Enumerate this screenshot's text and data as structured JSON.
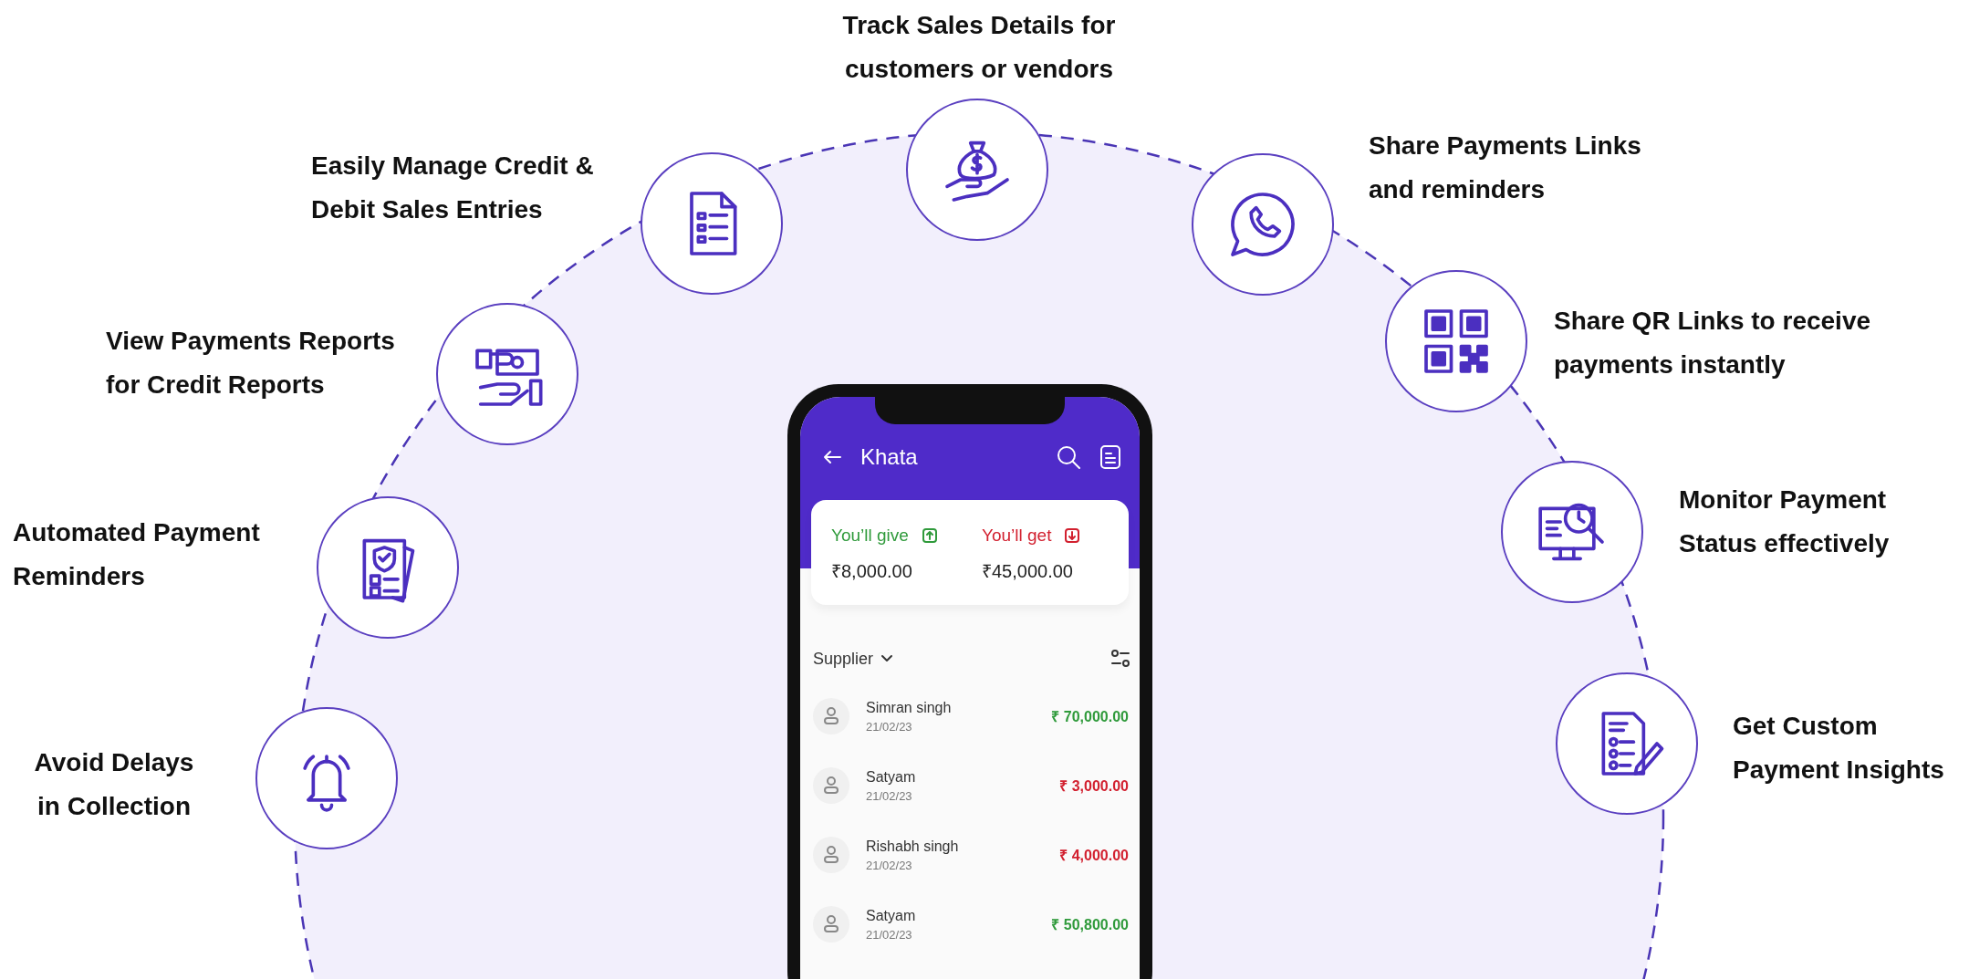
{
  "features": [
    {
      "kind": "moneybag",
      "lines": [
        "Track Sales Details for",
        "customers or vendors"
      ]
    },
    {
      "kind": "chat",
      "lines": [
        "Share Payments Links",
        "and reminders"
      ]
    },
    {
      "kind": "document",
      "lines": [
        "Easily Manage Credit &",
        "Debit Sales Entries"
      ]
    },
    {
      "kind": "qr",
      "lines": [
        "Share QR Links to receive",
        "payments instantly"
      ]
    },
    {
      "kind": "cash",
      "lines": [
        "View Payments Reports",
        "for Credit Reports"
      ]
    },
    {
      "kind": "monitor",
      "lines": [
        "Monitor Payment",
        "Status effectively"
      ]
    },
    {
      "kind": "checklist",
      "lines": [
        "Automated Payment",
        "Reminders"
      ]
    },
    {
      "kind": "report",
      "lines": [
        "Get Custom",
        "Payment Insights"
      ]
    },
    {
      "kind": "bell",
      "lines": [
        "Avoid Delays",
        "in Collection"
      ]
    }
  ],
  "phone": {
    "app_bar": {
      "title": "Khata"
    },
    "summary": [
      {
        "kind": "give",
        "label": "You’ll give",
        "amount": "₹8,000.00"
      },
      {
        "kind": "get",
        "label": "You’ll get",
        "amount": "₹45,000.00"
      }
    ],
    "filter": {
      "label": "Supplier"
    },
    "entries": [
      {
        "name": "Simran singh",
        "date": "21/02/23",
        "amount": "₹ 70,000.00",
        "kind": "give"
      },
      {
        "name": "Satyam",
        "date": "21/02/23",
        "amount": "₹ 3,000.00",
        "kind": "get"
      },
      {
        "name": "Rishabh singh",
        "date": "21/02/23",
        "amount": "₹ 4,000.00",
        "kind": "get"
      },
      {
        "name": "Satyam",
        "date": "21/02/23",
        "amount": "₹ 50,800.00",
        "kind": "give"
      }
    ]
  }
}
